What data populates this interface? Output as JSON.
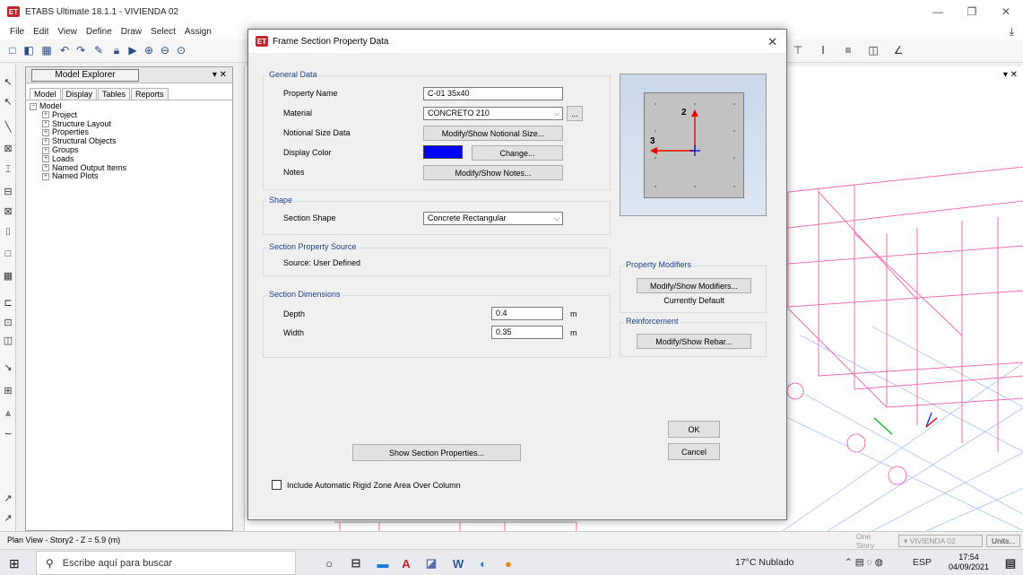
{
  "window": {
    "title": "ETABS Ultimate 18.1.1 - VIVIENDA 02",
    "logo": "ET",
    "controls": [
      "minimize-icon",
      "restore-icon",
      "close-icon"
    ]
  },
  "menu": [
    "File",
    "Edit",
    "View",
    "Define",
    "Draw",
    "Select",
    "Assign"
  ],
  "explorer": {
    "title": "Model Explorer",
    "tabs": [
      "Model",
      "Display",
      "Tables",
      "Reports"
    ],
    "tree_root": "Model",
    "tree_children": [
      "Project",
      "Structure Layout",
      "Properties",
      "Structural Objects",
      "Groups",
      "Loads",
      "Named Output Items",
      "Named Plots"
    ]
  },
  "dialog": {
    "title": "Frame Section Property Data",
    "general": {
      "group_label": "General Data",
      "property_name_label": "Property Name",
      "property_name_value": "C-01 35x40",
      "material_label": "Material",
      "material_value": "CONCRETO 210",
      "material_btn": "...",
      "notional_label": "Notional Size Data",
      "notional_btn": "Modify/Show Notional Size...",
      "color_label": "Display Color",
      "color_value": "#0000ff",
      "color_btn": "Change...",
      "notes_label": "Notes",
      "notes_btn": "Modify/Show Notes..."
    },
    "shape": {
      "group_label": "Shape",
      "section_shape_label": "Section Shape",
      "section_shape_value": "Concrete Rectangular"
    },
    "source": {
      "group_label": "Section Property Source",
      "source_text": "Source:  User Defined"
    },
    "dimensions": {
      "group_label": "Section Dimensions",
      "depth_label": "Depth",
      "depth_value": "0.4",
      "depth_unit": "m",
      "width_label": "Width",
      "width_value": "0.35",
      "width_unit": "m"
    },
    "modifiers": {
      "group_label": "Property Modifiers",
      "btn": "Modify/Show Modifiers...",
      "status": "Currently Default"
    },
    "reinforcement": {
      "group_label": "Reinforcement",
      "btn": "Modify/Show Rebar..."
    },
    "preview": {
      "axis2": "2",
      "axis3": "3"
    },
    "show_props_btn": "Show Section Properties...",
    "checkbox_label": "Include Automatic Rigid Zone Area Over Column",
    "ok": "OK",
    "cancel": "Cancel"
  },
  "status": {
    "plan_view": "Plan View - Story2 - Z = 5.9 (m)",
    "story": "One Story",
    "model": "VIVIENDA 02",
    "units": "Units..."
  },
  "taskbar": {
    "search_placeholder": "Escribe aquí para buscar",
    "weather": "17°C  Nublado",
    "lang": "ESP",
    "time": "17:54",
    "date": "04/09/2021"
  }
}
